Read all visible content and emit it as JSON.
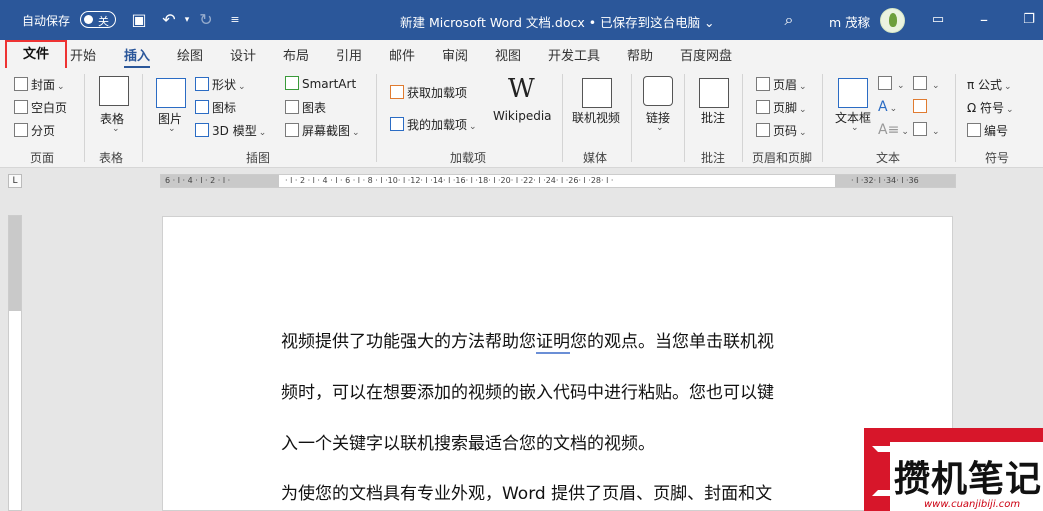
{
  "titlebar": {
    "autosave_label": "自动保存",
    "autosave_state": "关",
    "doc_title": "新建 Microsoft Word 文档.docx • 已保存到这台电脑 ⌄",
    "user_name": "m 茂稼"
  },
  "tabs": {
    "file": "文件",
    "items": [
      "开始",
      "插入",
      "绘图",
      "设计",
      "布局",
      "引用",
      "邮件",
      "审阅",
      "视图",
      "开发工具",
      "帮助",
      "百度网盘"
    ]
  },
  "ribbon": {
    "pages": {
      "cover": "封面",
      "blank": "空白页",
      "break": "分页",
      "label": "页面"
    },
    "tables": {
      "table": "表格",
      "label": "表格"
    },
    "illustrations": {
      "picture": "图片",
      "shapes": "形状",
      "icons": "图标",
      "model3d": "3D 模型",
      "smartart": "SmartArt",
      "chart": "图表",
      "screenshot": "屏幕截图",
      "label": "插图"
    },
    "addins": {
      "get": "获取加载项",
      "mine": "我的加载项",
      "wikipedia": "Wikipedia",
      "label": "加载项"
    },
    "media": {
      "video": "联机视频",
      "label": "媒体"
    },
    "links": {
      "link": "链接"
    },
    "comments": {
      "comment": "批注",
      "label": "批注"
    },
    "header_footer": {
      "header": "页眉",
      "footer": "页脚",
      "pagenum": "页码",
      "label": "页眉和页脚"
    },
    "text": {
      "textbox": "文本框",
      "label": "文本"
    },
    "symbols": {
      "equation": "π 公式",
      "symbol": "Ω 符号",
      "number": "编号",
      "label": "符号"
    }
  },
  "document": {
    "line1_before": "视频提供了功能强大的方法帮助您",
    "line1_underlined": "证明",
    "line1_after": "您的观点。当您单击联机视",
    "line2": "频时，可以在想要添加的视频的嵌入代码中进行粘贴。您也可以键",
    "line3": "入一个关键字以联机搜索最适合您的文档的视频。",
    "line4": "为使您的文档具有专业外观，Word  提供了页眉、页脚、封面和文"
  },
  "watermark": {
    "brand": "攒机笔记",
    "url": "www.cuanjibiji.com"
  }
}
